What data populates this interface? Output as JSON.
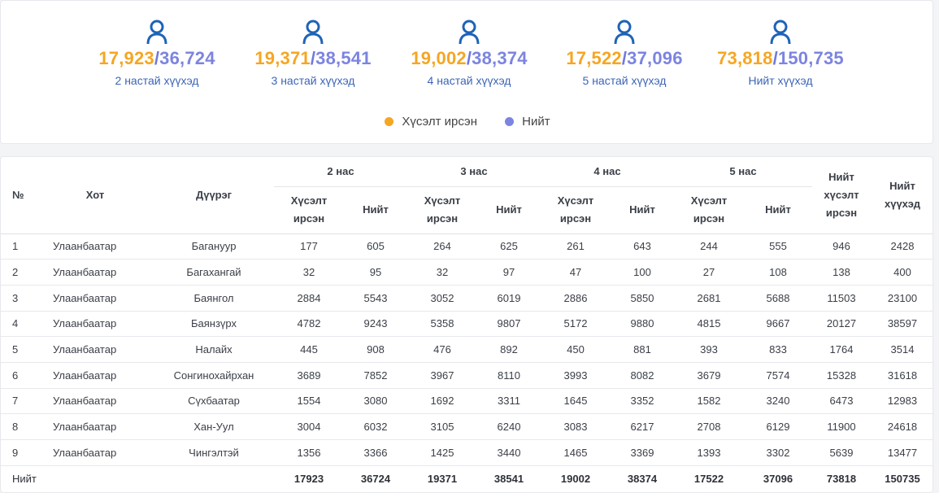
{
  "summary": [
    {
      "requested": "17,923",
      "total": "36,724",
      "label": "2 настай хүүхэд"
    },
    {
      "requested": "19,371",
      "total": "38,541",
      "label": "3 настай хүүхэд"
    },
    {
      "requested": "19,002",
      "total": "38,374",
      "label": "4 настай хүүхэд"
    },
    {
      "requested": "17,522",
      "total": "37,096",
      "label": "5 настай хүүхэд"
    },
    {
      "requested": "73,818",
      "total": "150,735",
      "label": "Нийт хүүхэд"
    }
  ],
  "legend": {
    "requested": {
      "label": "Хүсэлт ирсэн",
      "color": "#f5a623"
    },
    "total": {
      "label": "Нийт",
      "color": "#7c84e0"
    }
  },
  "table": {
    "headers": {
      "no": "№",
      "city": "Хот",
      "district": "Дүүрэг",
      "age_groups": [
        "2 нас",
        "3 нас",
        "4 нас",
        "5 нас"
      ],
      "requested": "Хүсэлт ирсэн",
      "total": "Нийт",
      "total_requested": "Нийт хүсэлт ирсэн",
      "total_children": "Нийт хүүхэд"
    },
    "rows": [
      [
        "1",
        "Улаанбаатар",
        "Баганууp",
        "177",
        "605",
        "264",
        "625",
        "261",
        "643",
        "244",
        "555",
        "946",
        "2428"
      ],
      [
        "2",
        "Улаанбаатар",
        "Багахангай",
        "32",
        "95",
        "32",
        "97",
        "47",
        "100",
        "27",
        "108",
        "138",
        "400"
      ],
      [
        "3",
        "Улаанбаатар",
        "Баянгол",
        "2884",
        "5543",
        "3052",
        "6019",
        "2886",
        "5850",
        "2681",
        "5688",
        "11503",
        "23100"
      ],
      [
        "4",
        "Улаанбаатар",
        "Баянзүрх",
        "4782",
        "9243",
        "5358",
        "9807",
        "5172",
        "9880",
        "4815",
        "9667",
        "20127",
        "38597"
      ],
      [
        "5",
        "Улаанбаатар",
        "Налайх",
        "445",
        "908",
        "476",
        "892",
        "450",
        "881",
        "393",
        "833",
        "1764",
        "3514"
      ],
      [
        "6",
        "Улаанбаатар",
        "Сонгинохайрхан",
        "3689",
        "7852",
        "3967",
        "8110",
        "3993",
        "8082",
        "3679",
        "7574",
        "15328",
        "31618"
      ],
      [
        "7",
        "Улаанбаатар",
        "Сүхбаатар",
        "1554",
        "3080",
        "1692",
        "3311",
        "1645",
        "3352",
        "1582",
        "3240",
        "6473",
        "12983"
      ],
      [
        "8",
        "Улаанбаатар",
        "Хан-Уул",
        "3004",
        "6032",
        "3105",
        "6240",
        "3083",
        "6217",
        "2708",
        "6129",
        "11900",
        "24618"
      ],
      [
        "9",
        "Улаанбаатар",
        "Чингэлтэй",
        "1356",
        "3366",
        "1425",
        "3440",
        "1465",
        "3369",
        "1393",
        "3302",
        "5639",
        "13477"
      ]
    ],
    "footer": [
      "Нийт",
      "17923",
      "36724",
      "19371",
      "38541",
      "19002",
      "38374",
      "17522",
      "37096",
      "73818",
      "150735"
    ]
  }
}
